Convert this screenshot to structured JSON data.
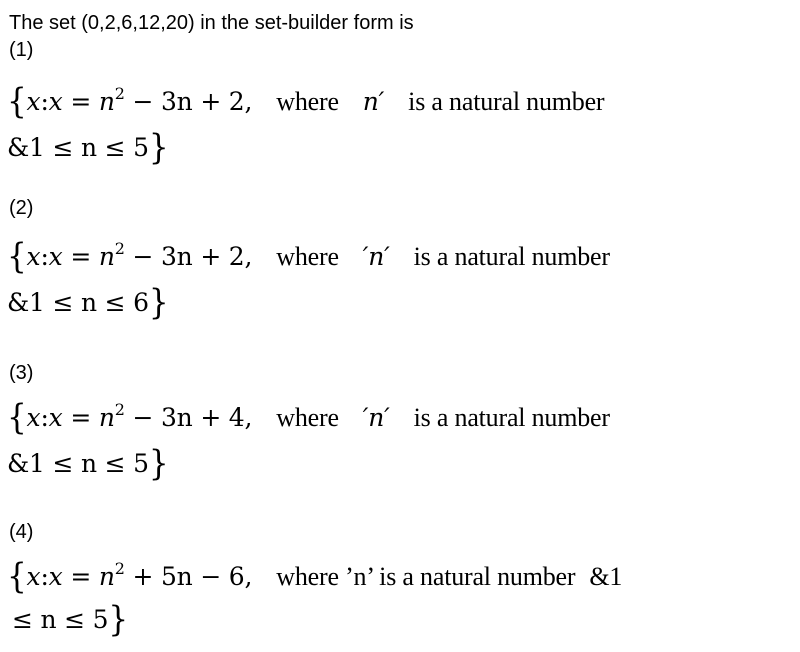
{
  "question": {
    "text": "The set (0,2,6,12,20) in the set-builder form is"
  },
  "options": [
    {
      "label": "(1)",
      "variable": "x",
      "formula_rhs": "n",
      "power": "2",
      "formula_tail": "− 3n + 2,",
      "where": "where",
      "n_mark": "n′",
      "tail": "is a natural number",
      "condition": "&1 ≤ n ≤ 5",
      "close": "}"
    },
    {
      "label": "(2)",
      "variable": "x",
      "formula_rhs": "n",
      "power": "2",
      "formula_tail": "− 3n + 2,",
      "where": "where",
      "n_mark": "′n′",
      "tail": "is a natural number",
      "condition": "&1 ≤ n ≤ 6",
      "close": "}"
    },
    {
      "label": "(3)",
      "variable": "x",
      "formula_rhs": "n",
      "power": "2",
      "formula_tail": "− 3n + 4,",
      "where": "where",
      "n_mark": "′n′",
      "tail": "is a natural number",
      "condition": "&1 ≤ n ≤ 5",
      "close": "}"
    },
    {
      "label": "(4)",
      "variable": "x",
      "formula_rhs": "n",
      "power": "2",
      "formula_tail": "+ 5n − 6,",
      "where_text": "where ’n’ is a natural number",
      "amp": "&1",
      "condition": "≤ n ≤ 5",
      "close": "}"
    }
  ],
  "symbols": {
    "open_brace": "{",
    "colon_eq": ":",
    "equals": "="
  }
}
